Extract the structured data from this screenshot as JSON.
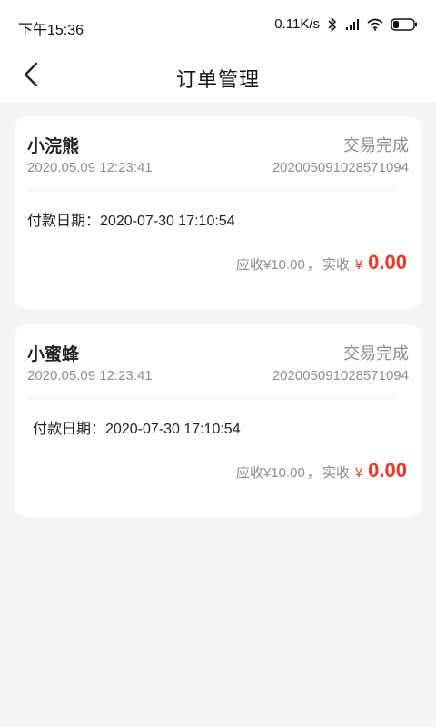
{
  "status_bar": {
    "time": "下午15:36",
    "speed": "0.11K/s",
    "icons": [
      "bluetooth-icon",
      "signal-icon",
      "wifi-icon",
      "battery-icon"
    ]
  },
  "nav": {
    "title": "订单管理",
    "back_icon": "chevron-left-icon"
  },
  "orders": [
    {
      "shop": "小浣熊",
      "status": "交易完成",
      "time": "2020.05.09 12:23:41",
      "order_no": "202005091028571094",
      "pay_label": "付款日期：",
      "pay_date": "2020-07-30 17:10:54",
      "receivable_label": "应收",
      "receivable": "¥10.00",
      "sep": "，",
      "actual_label": "实收",
      "currency": "¥",
      "actual": "0.00"
    },
    {
      "shop": "小蜜蜂",
      "status": "交易完成",
      "time": "2020.05.09 12:23:41",
      "order_no": "202005091028571094",
      "pay_label": "付款日期：",
      "pay_date": "2020-07-30 17:10:54",
      "receivable_label": "应收",
      "receivable": "¥10.00",
      "sep": "，",
      "actual_label": "实收",
      "currency": "¥",
      "actual": "0.00"
    }
  ],
  "colors": {
    "accent_red": "#e63a2b",
    "muted_text": "#8e8e8e",
    "background": "#f4f5f7"
  }
}
